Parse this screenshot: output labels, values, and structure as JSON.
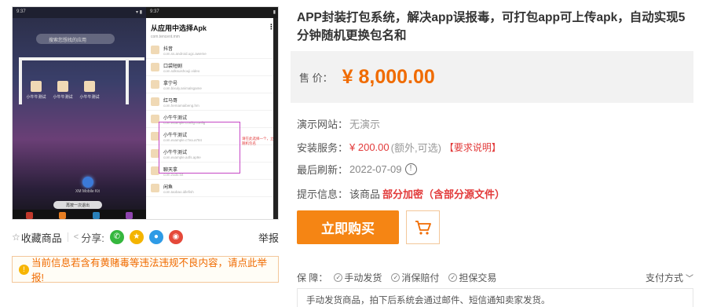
{
  "screenshot": {
    "left_status": "9:37",
    "right_status": "9:37",
    "search_placeholder": "搜索您想找的应用",
    "app_label": "小牛牛测试",
    "orb_label": "XM Mobile Kit",
    "toast": "再按一次退出",
    "dialog_title": "从应用中选择Apk",
    "dialog_sub": "com.tencent.mm",
    "apps": [
      {
        "name": "抖音",
        "pkg": "com.ss.android.ugc.aweme"
      },
      {
        "name": "口袋短剧",
        "pkg": "com.sdksuishouji.video"
      },
      {
        "name": "拿宁号",
        "pkg": "com.bixuly.animalsgame"
      },
      {
        "name": "红马哥",
        "pkg": "com.hemamaibeng.hm"
      },
      {
        "name": "小牛牛测试",
        "pkg": "com.example.config.config"
      },
      {
        "name": "小牛牛测试",
        "pkg": "com.example.c7ea.a784"
      },
      {
        "name": "小牛牛测试",
        "pkg": "com.example.a4fs.ap9e"
      },
      {
        "name": "聊天拿",
        "pkg": "com.zudx.txt"
      },
      {
        "name": "闲鱼",
        "pkg": "com.taobao.idlefish"
      }
    ],
    "highlight_note": "请在此选择一个，立即随机包名"
  },
  "share": {
    "favorite_label": "收藏商品",
    "share_label": "分享:",
    "report_label": "举报"
  },
  "warning": {
    "text": "当前信息若含有黄赌毒等违法违规不良内容，请点此举报!"
  },
  "product": {
    "title": "APP封装打包系统，解决app误报毒，可打包app可上传apk，自动实现5分钟随机更换包名和",
    "price_label": "售  价：",
    "price_value": "¥ 8,000.00",
    "demo_label": "演示网站：",
    "demo_value": "无演示",
    "install_label": "安装服务：",
    "install_price": "¥ 200.00",
    "install_note": "(额外,可选)",
    "install_req": "【要求说明】",
    "refresh_label": "最后刷新：",
    "refresh_date": "2022-07-09",
    "tip_label": "提示信息：",
    "tip_value": "该商品",
    "tip_source": "部分加密（含部分源文件）",
    "buy_label": "立即购买",
    "guarantee_label": "保  障：",
    "guarantees": [
      "手动发货",
      "消保赔付",
      "担保交易"
    ],
    "pay_label": "支付方式",
    "ship_text": "手动发货商品，拍下后系统会通过邮件、短信通知卖家发货。"
  },
  "colors": {
    "accent_orange": "#f58514",
    "price_orange": "#f06b00",
    "alert_red": "#e23a3a"
  }
}
